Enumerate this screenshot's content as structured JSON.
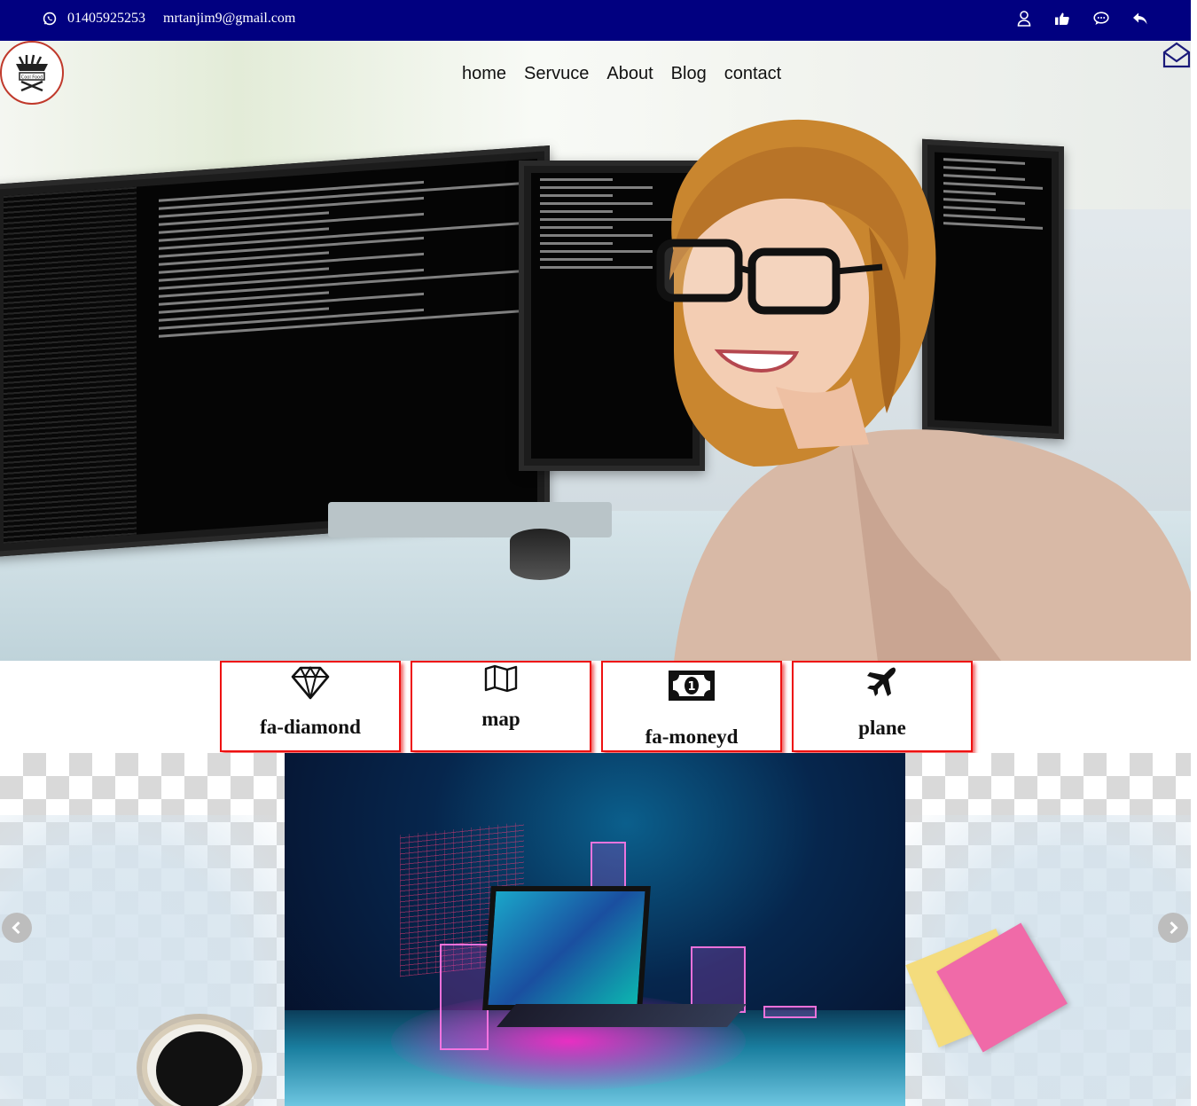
{
  "topbar": {
    "phone": "01405925253",
    "email": "mrtanjim9@gmail.com",
    "icons": [
      "whatsapp-icon",
      "user-icon",
      "thumbs-up-icon",
      "comment-icon",
      "reply-icon"
    ],
    "background": "#010080"
  },
  "header": {
    "logo_text": "Cool Food",
    "nav": [
      {
        "label": "home"
      },
      {
        "label": "Servuce"
      },
      {
        "label": "About"
      },
      {
        "label": "Blog"
      },
      {
        "label": "contact"
      }
    ],
    "mail_icon": "envelope-open-icon"
  },
  "features": [
    {
      "label": "fa-diamond",
      "icon": "diamond-icon"
    },
    {
      "label": "map",
      "icon": "map-icon"
    },
    {
      "label": "fa-moneyd",
      "icon": "money-icon"
    },
    {
      "label": "plane",
      "icon": "plane-icon"
    }
  ],
  "carousel": {
    "prev_icon": "chevron-left-icon",
    "next_icon": "chevron-right-icon"
  },
  "colors": {
    "accent_border": "#ee1111",
    "topbar": "#010080"
  }
}
